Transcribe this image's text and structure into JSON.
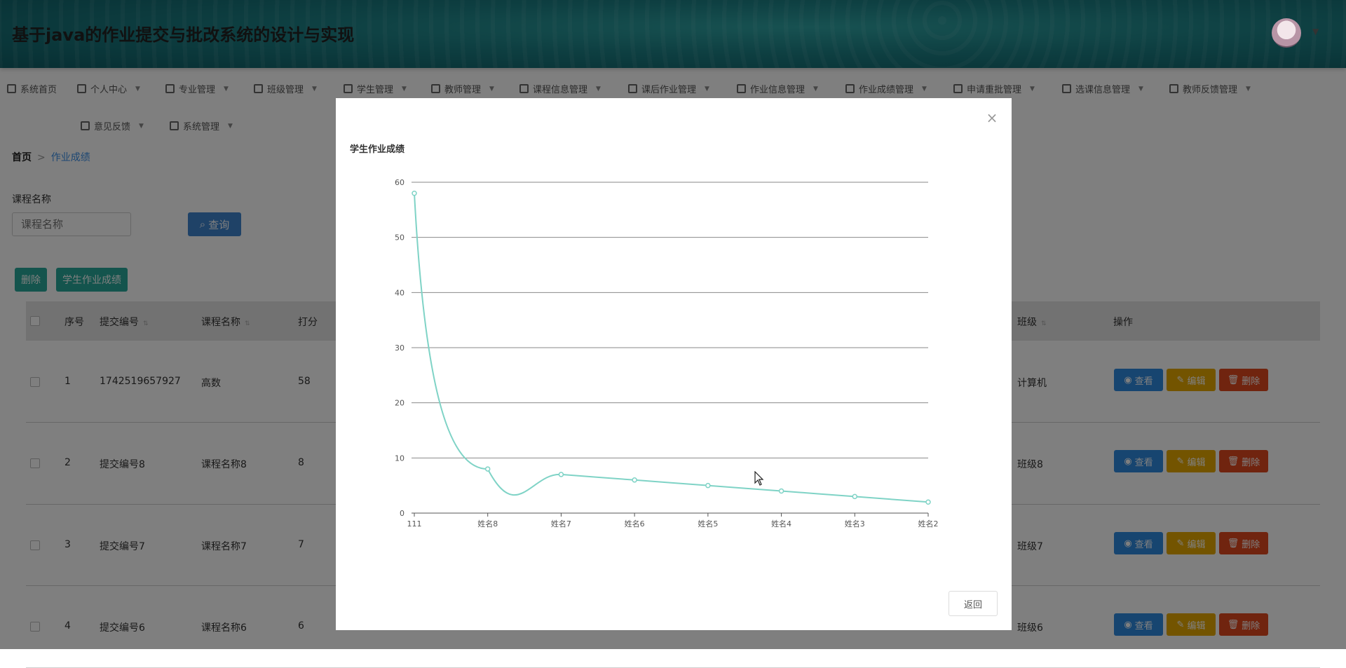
{
  "header": {
    "title": "基于java的作业提交与批改系统的设计与实现"
  },
  "nav": {
    "items": [
      {
        "label": "系统首页",
        "icon": "home-icon"
      },
      {
        "label": "个人中心",
        "icon": "window-icon"
      },
      {
        "label": "专业管理",
        "icon": "clipboard-icon"
      },
      {
        "label": "班级管理",
        "icon": "bar-chart-icon"
      },
      {
        "label": "学生管理",
        "icon": "flag-icon"
      },
      {
        "label": "教师管理",
        "icon": "monitor-icon"
      },
      {
        "label": "课程信息管理",
        "icon": "grid-icon"
      },
      {
        "label": "课后作业管理",
        "icon": "list-icon"
      },
      {
        "label": "作业信息管理",
        "icon": "table-icon"
      },
      {
        "label": "作业成绩管理",
        "icon": "clipboard-icon"
      },
      {
        "label": "申请重批管理",
        "icon": "grid-icon"
      },
      {
        "label": "选课信息管理",
        "icon": "list-icon"
      },
      {
        "label": "教师反馈管理",
        "icon": "briefcase-icon"
      },
      {
        "label": "意见反馈",
        "icon": "checkbox-icon"
      },
      {
        "label": "系统管理",
        "icon": "user-icon"
      }
    ]
  },
  "breadcrumb": {
    "home": "首页",
    "separator": ">",
    "current": "作业成绩"
  },
  "search": {
    "label": "课程名称",
    "placeholder": "课程名称",
    "button": "查询"
  },
  "toolbar": {
    "delete": "删除",
    "chart": "学生作业成绩"
  },
  "table": {
    "headers": {
      "index": "序号",
      "submit_no": "提交编号",
      "course": "课程名称",
      "score": "打分",
      "class": "班级",
      "actions": "操作"
    },
    "rows": [
      {
        "index": "1",
        "submit_no": "1742519657927",
        "course": "高数",
        "score": "58",
        "class": "计算机"
      },
      {
        "index": "2",
        "submit_no": "提交编号8",
        "course": "课程名称8",
        "score": "8",
        "class": "班级8"
      },
      {
        "index": "3",
        "submit_no": "提交编号7",
        "course": "课程名称7",
        "score": "7",
        "class": "班级7"
      },
      {
        "index": "4",
        "submit_no": "提交编号6",
        "course": "课程名称6",
        "score": "6",
        "class": "班级6"
      }
    ],
    "actions": {
      "view": "查看",
      "edit": "编辑",
      "delete": "删除"
    }
  },
  "modal": {
    "title": "学生作业成绩",
    "close": "×",
    "back": "返回"
  },
  "colors": {
    "accent": "#28a89a",
    "line": "#7fd3c6",
    "primary": "#3f85cf"
  },
  "chart_data": {
    "type": "line",
    "title": "学生作业成绩",
    "categories": [
      "111",
      "姓名8",
      "姓名7",
      "姓名6",
      "姓名5",
      "姓名4",
      "姓名3",
      "姓名2"
    ],
    "values": [
      58,
      8,
      7,
      6,
      5,
      4,
      3,
      2
    ],
    "ylim": [
      0,
      60
    ],
    "yticks": [
      "0",
      "10",
      "20",
      "30",
      "40",
      "50",
      "60"
    ],
    "grid": true,
    "smooth": true
  }
}
